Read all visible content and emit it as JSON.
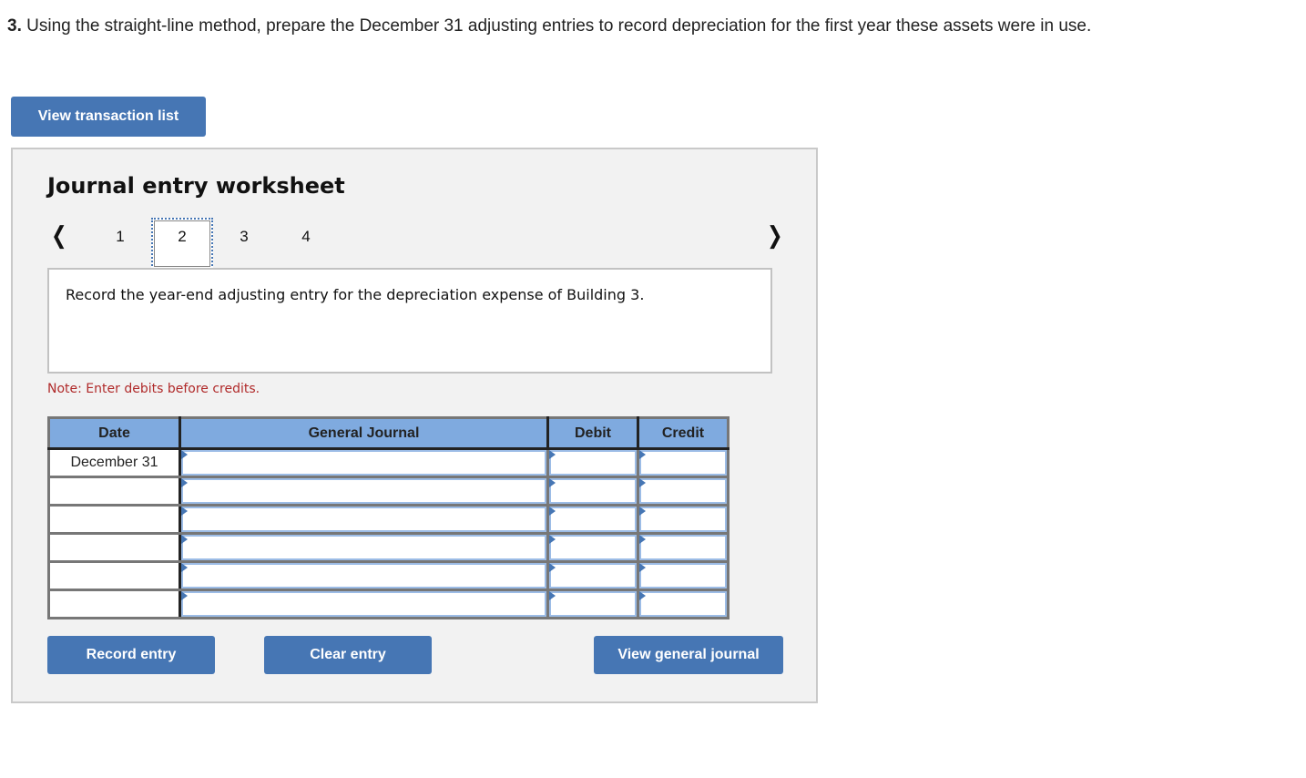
{
  "question": {
    "number": "3.",
    "text": " Using the straight-line method, prepare the December 31 adjusting entries to record depreciation for the first year these assets were in use."
  },
  "buttons": {
    "view_transaction_list": "View transaction list",
    "record_entry": "Record entry",
    "clear_entry": "Clear entry",
    "view_general_journal": "View general journal"
  },
  "worksheet": {
    "title": "Journal entry worksheet",
    "pages": [
      "1",
      "2",
      "3",
      "4"
    ],
    "active_page": "2",
    "prev_icon": "chevron-left-icon",
    "next_icon": "chevron-right-icon",
    "description": "Record the year-end adjusting entry for the depreciation expense of Building 3.",
    "note": "Note: Enter debits before credits.",
    "note_color": "#b02a2a"
  },
  "table": {
    "headers": [
      "Date",
      "General Journal",
      "Debit",
      "Credit"
    ],
    "rows": [
      {
        "date": "December 31",
        "account": "",
        "debit": "",
        "credit": ""
      },
      {
        "date": "",
        "account": "",
        "debit": "",
        "credit": ""
      },
      {
        "date": "",
        "account": "",
        "debit": "",
        "credit": ""
      },
      {
        "date": "",
        "account": "",
        "debit": "",
        "credit": ""
      },
      {
        "date": "",
        "account": "",
        "debit": "",
        "credit": ""
      },
      {
        "date": "",
        "account": "",
        "debit": "",
        "credit": ""
      }
    ]
  },
  "colors": {
    "button_blue": "#4676b4",
    "header_blue": "#7faadf",
    "panel_bg": "#f2f2f2"
  }
}
